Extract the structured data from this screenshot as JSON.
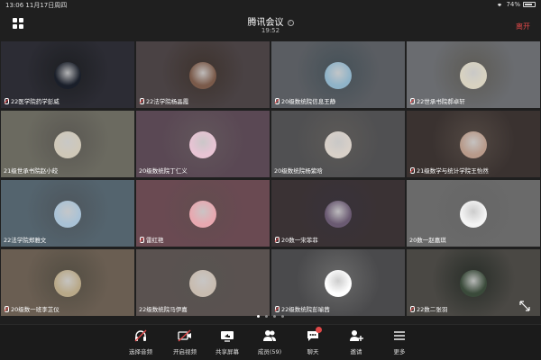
{
  "status_bar": {
    "time": "13:06",
    "date": "11月17日周四",
    "battery": "74%"
  },
  "header": {
    "title": "腾讯会议",
    "clock": "19:52",
    "leave_label": "离开"
  },
  "participants": [
    {
      "name": "22医学院药学彭威",
      "bg": "#2c2c34",
      "avatar": "#1a1f2a",
      "mic": true
    },
    {
      "name": "22法学院杨晶霞",
      "bg": "#4a4244",
      "avatar": "#7a5a4a",
      "mic": true
    },
    {
      "name": "20级数统院信息王静",
      "bg": "#5a5d62",
      "avatar": "#8fb3c8",
      "mic": true
    },
    {
      "name": "22世承书院郝卓轩",
      "bg": "#6a6c70",
      "avatar": "#d8d2c0",
      "mic": true
    },
    {
      "name": "21级世承书院赵小皎",
      "bg": "#6b6a60",
      "avatar": "#cfc8b8",
      "mic": false
    },
    {
      "name": "20级数统院丁仁义",
      "bg": "#5a4854",
      "avatar": "#e8c4d4",
      "mic": false
    },
    {
      "name": "20级数统院杨紫晗",
      "bg": "#505052",
      "avatar": "#d8d0c8",
      "mic": false
    },
    {
      "name": "21级数学与统计学院王怡然",
      "bg": "#3a3230",
      "avatar": "#b89a8a",
      "mic": true
    },
    {
      "name": "22法学院郑雅文",
      "bg": "#54646e",
      "avatar": "#a9c2d6",
      "mic": false
    },
    {
      "name": "雷红艳",
      "bg": "#6a4a52",
      "avatar": "#e8a8b0",
      "mic": true
    },
    {
      "name": "20数一宋菲菲",
      "bg": "#3a3234",
      "avatar": "#6a5a72",
      "mic": true
    },
    {
      "name": "20数一赵嘉琪",
      "bg": "#6a6a6a",
      "avatar": "#f4f4f4",
      "mic": false
    },
    {
      "name": "20级数一班李芷仪",
      "bg": "#6a5e52",
      "avatar": "#b8a888",
      "mic": true
    },
    {
      "name": "22级数统院马伊嘉",
      "bg": "#5a5250",
      "avatar": "#c8bcb0",
      "mic": false
    },
    {
      "name": "22级数统院彭瑜茜",
      "bg": "#4a4a4c",
      "avatar": "#ffffff",
      "mic": true
    },
    {
      "name": "22数二张羽",
      "bg": "#4a4844",
      "avatar": "#3a4a3a",
      "mic": true
    }
  ],
  "toolbar": {
    "mic_label": "选择音频",
    "video_label": "开启视频",
    "share_label": "共享屏幕",
    "members_label": "成员(59)",
    "chat_label": "聊天",
    "invite_label": "邀请",
    "more_label": "更多"
  }
}
